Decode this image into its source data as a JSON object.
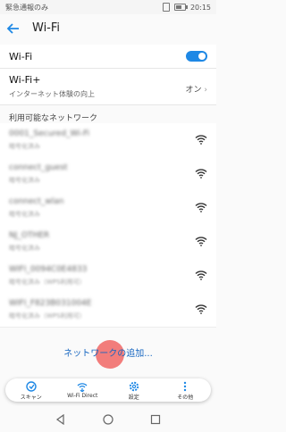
{
  "status_bar": {
    "left_text": "緊急通報のみ",
    "time": "20:15",
    "battery_level": 0.7
  },
  "header": {
    "title": "Wi-Fi"
  },
  "wifi_toggle": {
    "label": "Wi-Fi",
    "on": true
  },
  "wifi_plus": {
    "label": "Wi-Fi+",
    "subtitle": "インターネット体験の向上",
    "state": "オン"
  },
  "networks_section": {
    "title": "利用可能なネットワーク"
  },
  "networks": [
    {
      "name": "0001_Secured_Wi-Fi",
      "desc": "暗号化済み"
    },
    {
      "name": "connect_guest",
      "desc": "暗号化済み"
    },
    {
      "name": "connect_wlan",
      "desc": "暗号化済み"
    },
    {
      "name": "NJ_OTHER",
      "desc": "暗号化済み"
    },
    {
      "name": "WIFI_0094C0E4833",
      "desc": "暗号化済み（WPS利用可）"
    },
    {
      "name": "WIFI_F823B031004E",
      "desc": "暗号化済み（WPS利用可）"
    }
  ],
  "add_network": {
    "label": "ネットワークの追加..."
  },
  "toolbar": [
    {
      "label": "スキャン",
      "icon": "scan-icon"
    },
    {
      "label": "Wi-Fi Direct",
      "icon": "wifi-direct-icon"
    },
    {
      "label": "設定",
      "icon": "gear-icon"
    },
    {
      "label": "その他",
      "icon": "more-icon"
    }
  ],
  "colors": {
    "accent": "#1e88e5",
    "link": "#1565c0",
    "tap": "#ef5350"
  }
}
